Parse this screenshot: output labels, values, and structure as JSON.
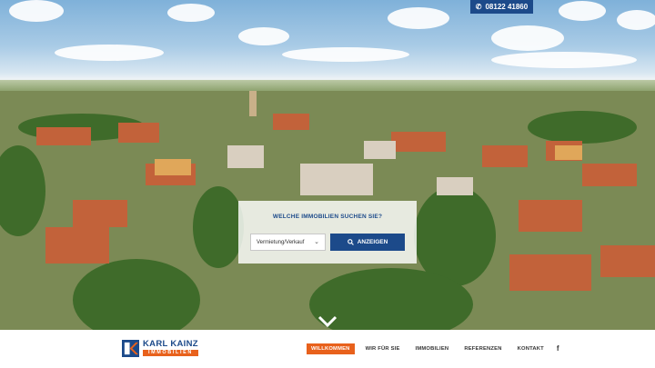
{
  "header": {
    "phone_icon": "phone-icon",
    "phone_number": "08122 41860"
  },
  "search": {
    "title": "WELCHE IMMOBILIEN SUCHEN SIE?",
    "type_select_value": "Vermietung/Verkauf",
    "button_label": "ANZEIGEN",
    "button_icon": "search-icon"
  },
  "scroll": {
    "icon": "chevron-down-icon"
  },
  "logo": {
    "name": "KARL KAINZ",
    "subtitle": "IMMOBILIEN"
  },
  "nav": {
    "items": [
      {
        "label": "WILLKOMMEN",
        "active": true
      },
      {
        "label": "WIR FÜR SIE",
        "active": false
      },
      {
        "label": "IMMOBILIEN",
        "active": false
      },
      {
        "label": "REFERENZEN",
        "active": false
      },
      {
        "label": "KONTAKT",
        "active": false
      }
    ],
    "social_icon": "facebook-icon",
    "social_glyph": "f"
  },
  "colors": {
    "brand_blue": "#1c4a8a",
    "brand_orange": "#e8611c"
  }
}
